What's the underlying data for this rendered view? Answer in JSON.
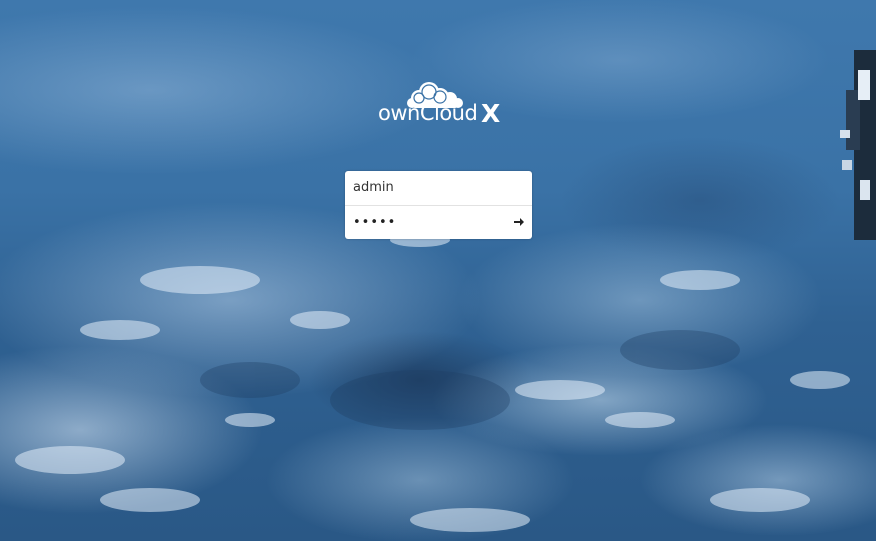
{
  "logo": {
    "brand_text": "ownCloud",
    "suffix": "X",
    "icon": "owncloud-cloud-icon"
  },
  "login": {
    "username_value": "admin",
    "password_value": "•••••",
    "submit_icon": "arrow-right-icon"
  },
  "colors": {
    "background": "#3a72a6",
    "field_bg": "#ffffff",
    "text": "#333333"
  }
}
